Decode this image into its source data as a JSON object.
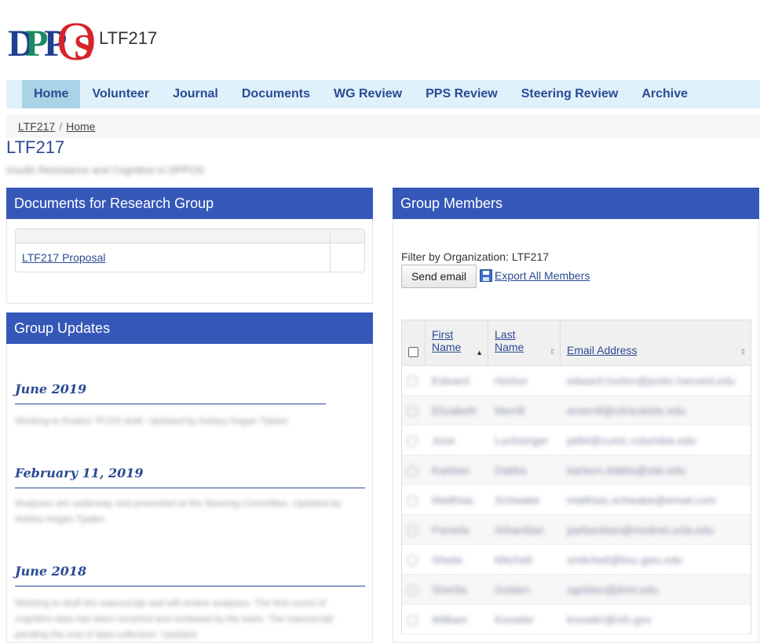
{
  "header": {
    "logo_text": "DPPOS",
    "site_name": "LTF217"
  },
  "nav": {
    "items": [
      {
        "label": "Home",
        "active": true
      },
      {
        "label": "Volunteer",
        "active": false
      },
      {
        "label": "Journal",
        "active": false
      },
      {
        "label": "Documents",
        "active": false
      },
      {
        "label": "WG Review",
        "active": false
      },
      {
        "label": "PPS Review",
        "active": false
      },
      {
        "label": "Steering Review",
        "active": false
      },
      {
        "label": "Archive",
        "active": false
      }
    ]
  },
  "breadcrumb": {
    "item1": "LTF217",
    "separator": "/",
    "item2": "Home"
  },
  "page": {
    "title": "LTF217",
    "subtitle": "Insulin Resistance and Cognition in DPPOS"
  },
  "documents_panel": {
    "title": "Documents for Research Group",
    "rows": [
      {
        "link": "LTF217 Proposal"
      }
    ]
  },
  "updates_panel": {
    "title": "Group Updates",
    "updates": [
      {
        "date": "June 2019",
        "text": "Working to finalize TF220 draft. Updated by Ashley Hogan Tjaden"
      },
      {
        "date": "February 11, 2019",
        "text": "Analyses are underway and presented at the Steering Committee. Updated by Ashley Hogan Tjaden"
      },
      {
        "date": "June 2018",
        "text": "Working to draft the manuscript and will review analyses. The first round of cognitive data has been received and reviewed by the team. The manuscript pending the end of data collection. Updated"
      }
    ]
  },
  "members_panel": {
    "title": "Group Members",
    "filter_label": "Filter by Organization: LTF217",
    "send_email_label": "Send email",
    "export_label": "Export All Members",
    "columns": {
      "first_name": "First Name",
      "first_name_line1": "First",
      "first_name_line2": "Name",
      "last_name_line1": "Last",
      "last_name_line2": "Name",
      "email": "Email Address"
    },
    "rows": [
      {
        "first": "Edward",
        "last": "Horton",
        "email": "edward.horton@joslin.harvard.edu"
      },
      {
        "first": "Elizabeth",
        "last": "Merrill",
        "email": "emerrill@clinicalsite.edu"
      },
      {
        "first": "Jose",
        "last": "Luchsinger",
        "email": "jal94@cumc.columbia.edu"
      },
      {
        "first": "Karleen",
        "last": "Dabbs",
        "email": "karleen.dabbs@site.edu"
      },
      {
        "first": "Matthias",
        "last": "Schwabe",
        "email": "matthias.schwabe@email.com"
      },
      {
        "first": "Pamela",
        "last": "Arbanitian",
        "email": "parbanitian@mednet.ucla.edu"
      },
      {
        "first": "Sheila",
        "last": "Mitchell",
        "email": "smitchell@bsc.gwu.edu"
      },
      {
        "first": "Sherita",
        "last": "Golden",
        "email": "sgolden@jhmi.edu"
      },
      {
        "first": "William",
        "last": "Knowler",
        "email": "knowler@nih.gov"
      }
    ]
  }
}
